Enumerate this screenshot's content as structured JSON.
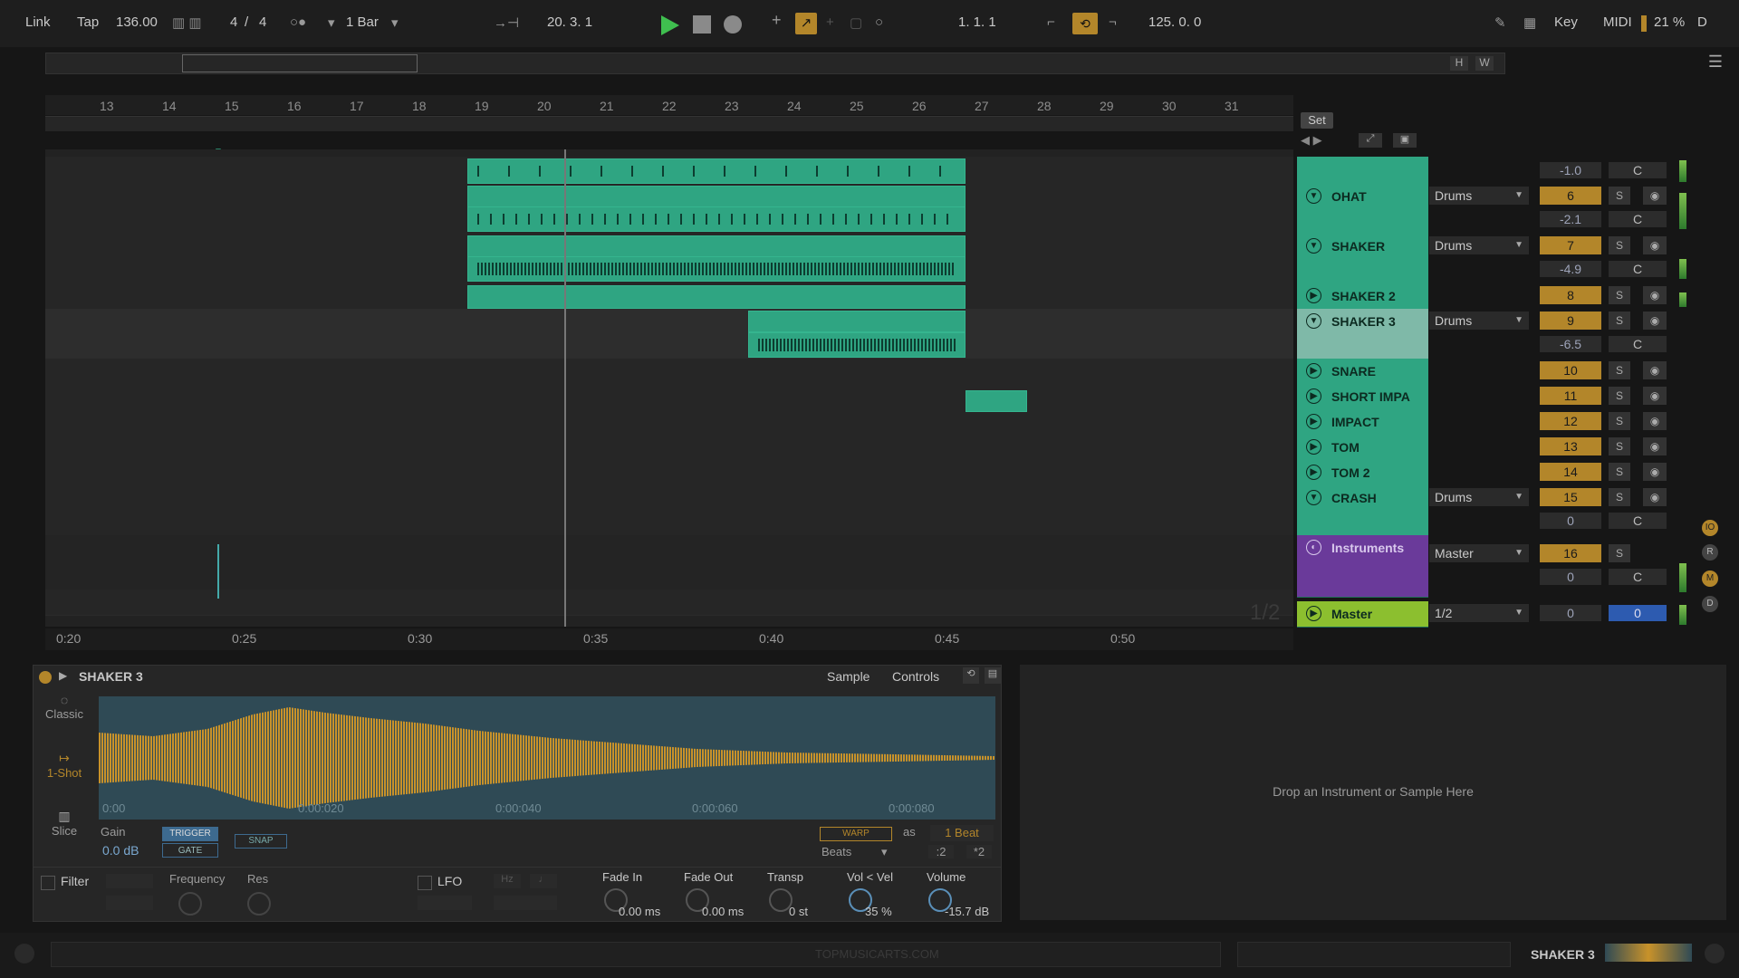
{
  "transport": {
    "link": "Link",
    "tap": "Tap",
    "tempo": "136.00",
    "sig_num": "4",
    "sig_sep": "/",
    "sig_den": "4",
    "quantize": "1 Bar",
    "position": "20.  3.  1",
    "loop_start": "1.  1.  1",
    "loop_len": "125.  0.  0",
    "key": "Key",
    "midi": "MIDI",
    "cpu": "21 %",
    "d": "D"
  },
  "ruler": {
    "bars": [
      "13",
      "14",
      "15",
      "16",
      "17",
      "18",
      "19",
      "20",
      "21",
      "22",
      "23",
      "24",
      "25",
      "26",
      "27",
      "28",
      "29",
      "30",
      "31"
    ]
  },
  "set_label": "Set",
  "timeline": {
    "times": [
      "0:20",
      "0:25",
      "0:30",
      "0:35",
      "0:40",
      "0:45",
      "0:50"
    ]
  },
  "page_indicator": "1/2",
  "tracks": [
    {
      "name": "",
      "input": "",
      "number": "",
      "volume": "-1.0",
      "pan": "C"
    },
    {
      "name": "OHAT",
      "input": "Drums",
      "number": "6",
      "volume": "-2.1",
      "pan": "C"
    },
    {
      "name": "SHAKER",
      "input": "Drums",
      "number": "7",
      "volume": "-4.9",
      "pan": "C"
    },
    {
      "name": "SHAKER 2",
      "input": "",
      "number": "8",
      "volume": "",
      "pan": ""
    },
    {
      "name": "SHAKER 3",
      "input": "Drums",
      "number": "9",
      "volume": "-6.5",
      "pan": "C"
    },
    {
      "name": "SNARE",
      "input": "",
      "number": "10",
      "volume": "",
      "pan": ""
    },
    {
      "name": "SHORT IMPA",
      "input": "",
      "number": "11",
      "volume": "",
      "pan": ""
    },
    {
      "name": "IMPACT",
      "input": "",
      "number": "12",
      "volume": "",
      "pan": ""
    },
    {
      "name": "TOM",
      "input": "",
      "number": "13",
      "volume": "",
      "pan": ""
    },
    {
      "name": "TOM 2",
      "input": "",
      "number": "14",
      "volume": "",
      "pan": ""
    },
    {
      "name": "CRASH",
      "input": "Drums",
      "number": "15",
      "volume": "0",
      "pan": "C"
    },
    {
      "name": "Instruments",
      "input": "Master",
      "number": "16",
      "volume": "0",
      "pan": "C"
    },
    {
      "name": "Master",
      "input": "1/2",
      "number": "",
      "volume": "0",
      "pan": "0"
    }
  ],
  "device": {
    "title": "SHAKER 3",
    "tab_sample": "Sample",
    "tab_controls": "Controls",
    "mode_classic": "Classic",
    "mode_oneshot": "1-Shot",
    "mode_slice": "Slice",
    "wave_times": [
      "0:00",
      "0:00:020",
      "0:00:040",
      "0:00:060",
      "0:00:080"
    ],
    "gain_label": "Gain",
    "gain_value": "0.0 dB",
    "trigger": "TRIGGER",
    "gate": "GATE",
    "snap": "SNAP",
    "warp": "WARP",
    "as": "as",
    "beat": "1 Beat",
    "beats": "Beats",
    "half": ":2",
    "double": "*2",
    "filter": "Filter",
    "frequency": "Frequency",
    "res": "Res",
    "lfo": "LFO",
    "hz": "Hz",
    "fade_in_label": "Fade In",
    "fade_in_value": "0.00 ms",
    "fade_out_label": "Fade Out",
    "fade_out_value": "0.00 ms",
    "transp_label": "Transp",
    "transp_value": "0 st",
    "volvel_label": "Vol < Vel",
    "volvel_value": "35 %",
    "volume_label": "Volume",
    "volume_value": "-15.7 dB"
  },
  "dropzone_text": "Drop an Instrument or Sample Here",
  "footer": {
    "watermark": "TOPMUSICARTS.COM",
    "selected_track": "SHAKER 3"
  },
  "colors": {
    "clip": "#2fa582",
    "instruments": "#6a3a9a",
    "master": "#8cbf2f",
    "accent": "#b3862a",
    "play": "#3fbf4f"
  }
}
